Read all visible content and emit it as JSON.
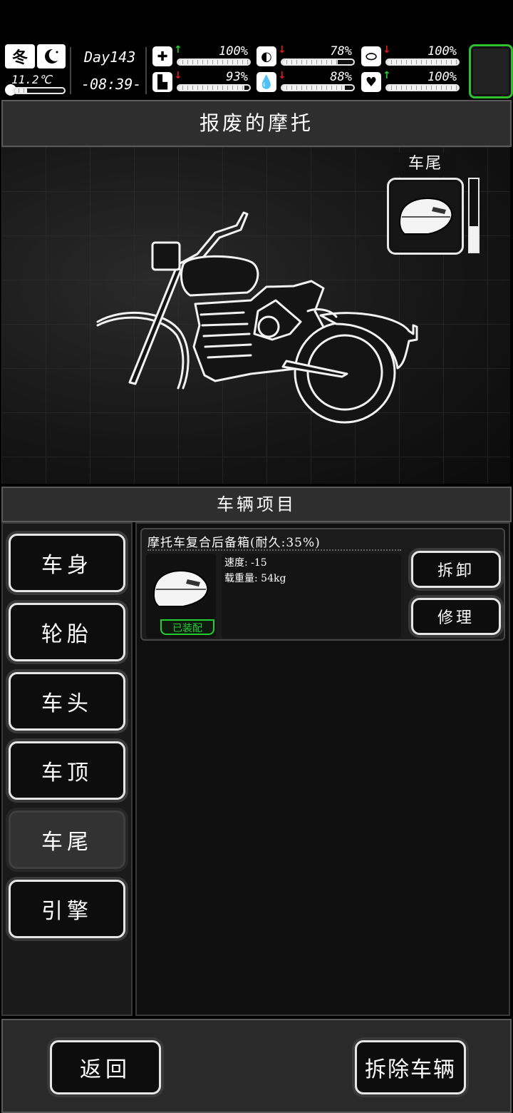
{
  "hud": {
    "season": "冬",
    "temperature": "11.2℃",
    "temperature_level": 0.25,
    "day": "Day143",
    "time": "-08:39-",
    "stats": [
      {
        "icon": "medkit-icon",
        "trend": "up",
        "percent_text": "100%",
        "level": 1.0
      },
      {
        "icon": "stomach-icon",
        "trend": "down",
        "percent_text": "78%",
        "level": 0.78
      },
      {
        "icon": "pill-icon",
        "trend": "down",
        "percent_text": "100%",
        "level": 1.0
      },
      {
        "icon": "boot-icon",
        "trend": "down",
        "percent_text": "93%",
        "level": 0.93
      },
      {
        "icon": "water-drop-icon",
        "trend": "down",
        "percent_text": "88%",
        "level": 0.88
      },
      {
        "icon": "heart-icon",
        "trend": "up",
        "percent_text": "100%",
        "level": 1.0
      }
    ],
    "up_arrow": "↑",
    "down_arrow": "↓"
  },
  "page_title": "报废的摩托",
  "slot_preview": {
    "label": "车尾",
    "level": 0.35
  },
  "section_title": "车辆项目",
  "tabs": [
    {
      "label": "车身",
      "active": false
    },
    {
      "label": "轮胎",
      "active": false
    },
    {
      "label": "车头",
      "active": false
    },
    {
      "label": "车顶",
      "active": false
    },
    {
      "label": "车尾",
      "active": true
    },
    {
      "label": "引擎",
      "active": false
    }
  ],
  "item": {
    "name": "摩托车复合后备箱(耐久:35%)",
    "stat_speed": "速度: -15",
    "stat_load": "载重量: 54kg",
    "badge": "已装配",
    "remove_label": "拆卸",
    "repair_label": "修理"
  },
  "footer": {
    "back_label": "返回",
    "dismantle_label": "拆除车辆"
  },
  "colors": {
    "equipped_green": "#21d02f",
    "accent_green": "#2fbf2f",
    "up_green": "#19d12a",
    "down_red": "#e01919"
  }
}
